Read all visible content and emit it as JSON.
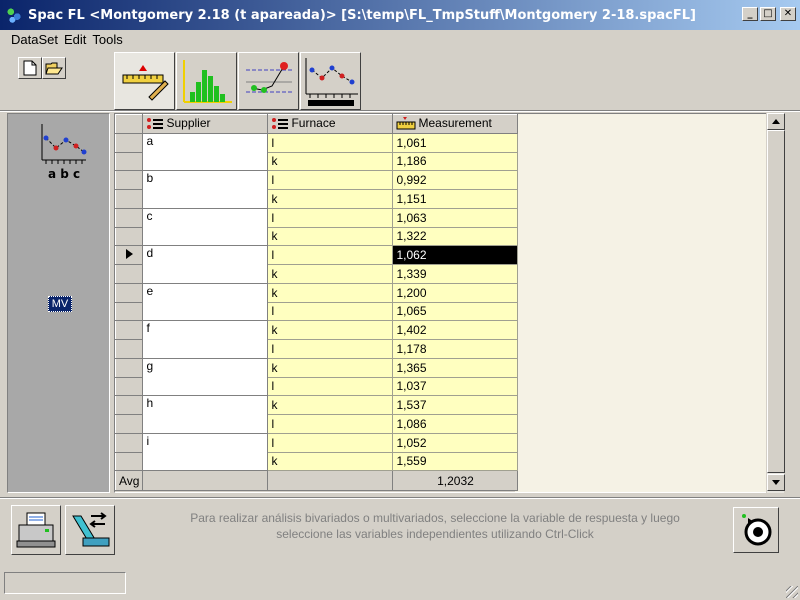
{
  "window": {
    "title": "Spac FL <Montgomery 2.18 (t apareada)> [S:\\temp\\FL_TmpStuff\\Montgomery 2-18.spacFL]",
    "minimize": "_",
    "maximize": "□",
    "close": "✕"
  },
  "menu": {
    "items": [
      "DataSet",
      "Edit",
      "Tools"
    ]
  },
  "left_panel": {
    "mv_label": "MV",
    "mv_letters": "a b c"
  },
  "grid": {
    "columns": [
      "Supplier",
      "Furnace",
      "Measurement"
    ],
    "rows": [
      {
        "supplier": "a",
        "furnace": "l",
        "measurement": "1,061"
      },
      {
        "supplier": "",
        "furnace": "k",
        "measurement": "1,186"
      },
      {
        "supplier": "b",
        "furnace": "l",
        "measurement": "0,992"
      },
      {
        "supplier": "",
        "furnace": "k",
        "measurement": "1,151"
      },
      {
        "supplier": "c",
        "furnace": "l",
        "measurement": "1,063"
      },
      {
        "supplier": "",
        "furnace": "k",
        "measurement": "1,322"
      },
      {
        "supplier": "d",
        "furnace": "l",
        "measurement": "1,062"
      },
      {
        "supplier": "",
        "furnace": "k",
        "measurement": "1,339"
      },
      {
        "supplier": "e",
        "furnace": "k",
        "measurement": "1,200"
      },
      {
        "supplier": "",
        "furnace": "l",
        "measurement": "1,065"
      },
      {
        "supplier": "f",
        "furnace": "k",
        "measurement": "1,402"
      },
      {
        "supplier": "",
        "furnace": "l",
        "measurement": "1,178"
      },
      {
        "supplier": "g",
        "furnace": "k",
        "measurement": "1,365"
      },
      {
        "supplier": "",
        "furnace": "l",
        "measurement": "1,037"
      },
      {
        "supplier": "h",
        "furnace": "k",
        "measurement": "1,537"
      },
      {
        "supplier": "",
        "furnace": "l",
        "measurement": "1,086"
      },
      {
        "supplier": "i",
        "furnace": "l",
        "measurement": "1,052"
      },
      {
        "supplier": "",
        "furnace": "k",
        "measurement": "1,559"
      }
    ],
    "selected_row": 6,
    "avg_label": "Avg",
    "avg_value": "1,2032"
  },
  "hint": {
    "line1": "Para realizar análisis bivariados o multivariados, seleccione la variable de respuesta y luego",
    "line2": "seleccione las variables independientes utilizando Ctrl-Click"
  },
  "colors": {
    "title_start": "#0a246a",
    "title_end": "#a6caf0",
    "cell_yellow": "#ffffc0",
    "selection": "#000000"
  }
}
